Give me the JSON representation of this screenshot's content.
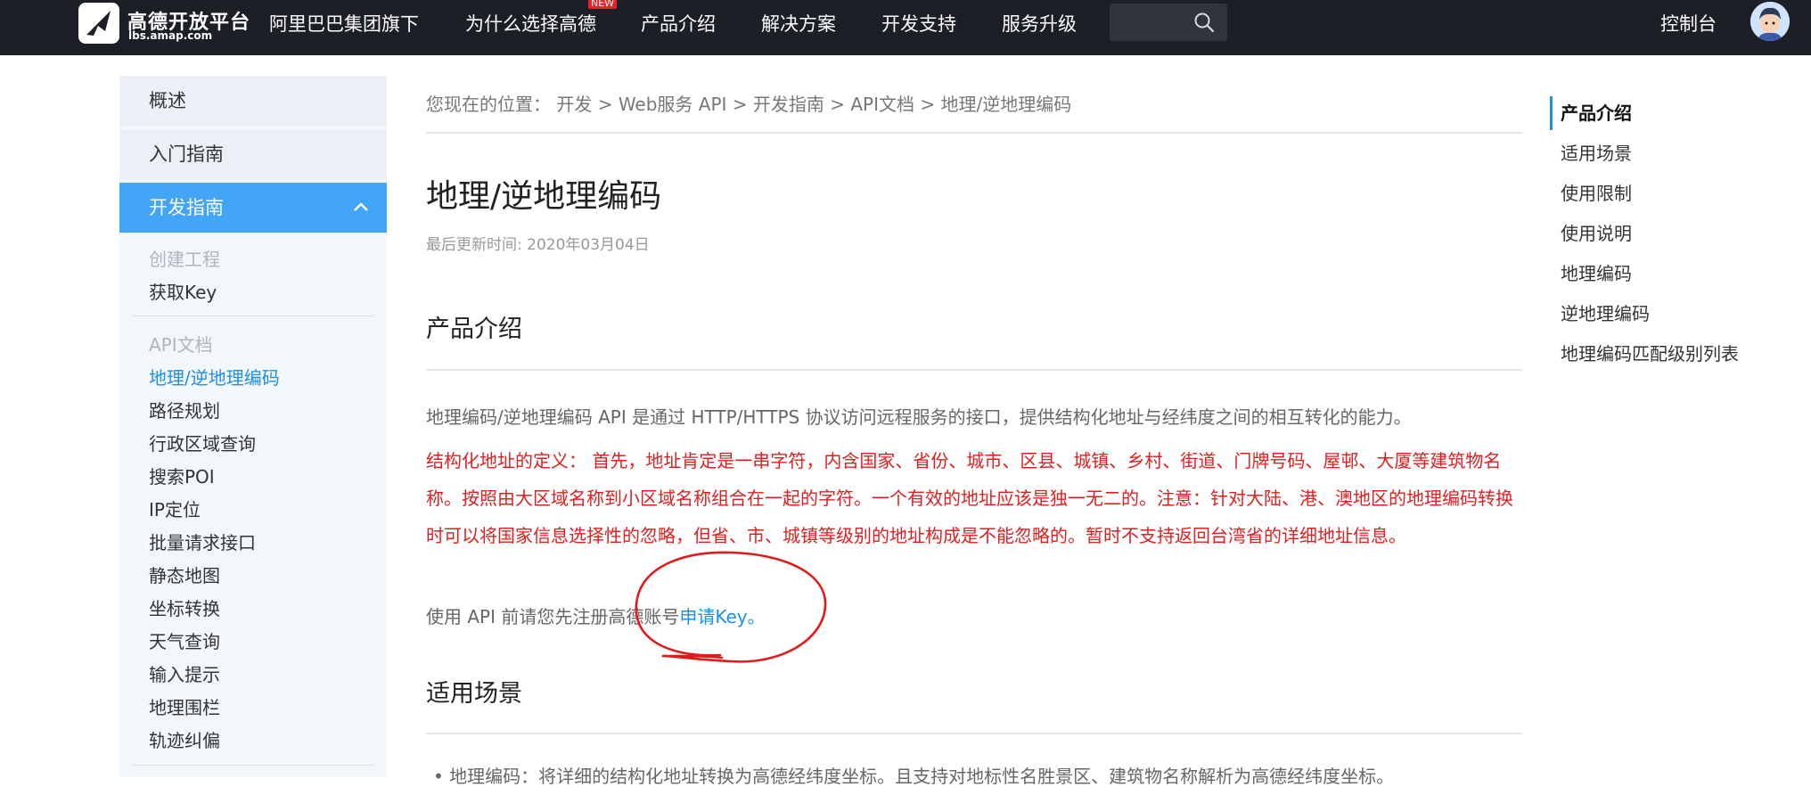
{
  "nav": {
    "logo_cn": "高德开放平台",
    "logo_en": "lbs.amap.com",
    "items": [
      "阿里巴巴集团旗下",
      "为什么选择高德",
      "产品介绍",
      "解决方案",
      "开发支持",
      "服务升级"
    ],
    "badge": "NEW",
    "search_placeholder": "",
    "console": "控制台"
  },
  "sidebar": {
    "overview": "概述",
    "getting_started": "入门指南",
    "dev_guide": "开发指南",
    "sub_a": [
      "创建工程",
      "获取Key"
    ],
    "sub_b": [
      "API文档",
      "地理/逆地理编码",
      "路径规划",
      "行政区域查询",
      "搜索POI",
      "IP定位",
      "批量请求接口",
      "静态地图",
      "坐标转换",
      "天气查询",
      "输入提示",
      "地理围栏",
      "轨迹纠偏"
    ]
  },
  "breadcrumb": "您现在的位置：  开发 > Web服务 API > 开发指南 > API文档 > 地理/逆地理编码",
  "content": {
    "title": "地理/逆地理编码",
    "updated": "最后更新时间: 2020年03月04日",
    "section1": "产品介绍",
    "intro": "地理编码/逆地理编码 API 是通过 HTTP/HTTPS 协议访问远程服务的接口，提供结构化地址与经纬度之间的相互转化的能力。",
    "definition": "结构化地址的定义： 首先，地址肯定是一串字符，内含国家、省份、城市、区县、城镇、乡村、街道、门牌号码、屋邨、大厦等建筑物名称。按照由大区域名称到小区域名称组合在一起的字符。一个有效的地址应该是独一无二的。注意：针对大陆、港、澳地区的地理编码转换时可以将国家信息选择性的忽略，但省、市、城镇等级别的地址构成是不能忽略的。暂时不支持返回台湾省的详细地址信息。",
    "key_prefix": "使用 API 前请您先注册高德账号",
    "key_link": "申请Key。",
    "section2": "适用场景",
    "cut_line": "• 地理编码：将详细的结构化地址转换为高德经纬度坐标。且支持对地标性名胜景区、建筑物名称解析为高德经纬度坐标。"
  },
  "toc": [
    "产品介绍",
    "适用场景",
    "使用限制",
    "使用说明",
    "地理编码",
    "逆地理编码",
    "地理编码匹配级别列表"
  ],
  "colors": {
    "nav_bg": "#1c1f26",
    "accent": "#1e8ee8",
    "active_sidebar": "#42a5f5",
    "warning_text": "#e02020"
  }
}
